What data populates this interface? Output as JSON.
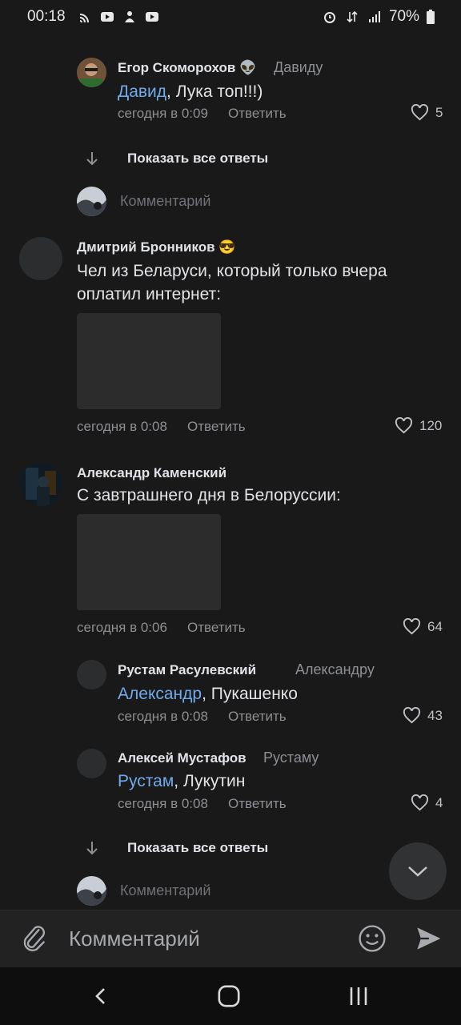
{
  "status_bar": {
    "time": "00:18",
    "battery": "70%",
    "icons": [
      "cast-icon",
      "youtube-icon",
      "app-icon",
      "youtube-icon",
      "alarm-icon",
      "data-icon",
      "signal-icon",
      "battery-icon"
    ]
  },
  "comments": {
    "egor": {
      "author": "Егор Скоморохов 👽",
      "reply_to": "Давиду",
      "mention": "Давид",
      "text": ", Лука топ!!!)",
      "time": "сегодня в 0:09",
      "reply_label": "Ответить",
      "likes": "5"
    },
    "show_all_1": "Показать все ответы",
    "prompt_1": "Комментарий",
    "dmitry": {
      "author": "Дмитрий Бронников 😎",
      "text": "Чел из Беларуси, который только вчера оплатил интернет:",
      "time": "сегодня в 0:08",
      "reply_label": "Ответить",
      "likes": "120"
    },
    "aleksandr": {
      "author": "Александр Каменский",
      "text": "С завтрашнего дня в Белоруссии:",
      "time": "сегодня в 0:06",
      "reply_label": "Ответить",
      "likes": "64"
    },
    "rustam": {
      "author": "Рустам Расулевский",
      "reply_to": "Александру",
      "mention": "Александр",
      "text": ", Пукашенко",
      "time": "сегодня в 0:08",
      "reply_label": "Ответить",
      "likes": "43"
    },
    "aleksei": {
      "author": "Алексей Мустафов",
      "reply_to": "Рустаму",
      "mention": "Рустам",
      "text": ", Лукутин",
      "time": "сегодня в 0:08",
      "reply_label": "Ответить",
      "likes": "4"
    },
    "show_all_2": "Показать все ответы",
    "prompt_2": "Комментарий"
  },
  "composer": {
    "placeholder": "Комментарий"
  },
  "colors": {
    "background": "#19191a",
    "mention": "#71aaeb",
    "secondary_text": "#8d8f93"
  }
}
